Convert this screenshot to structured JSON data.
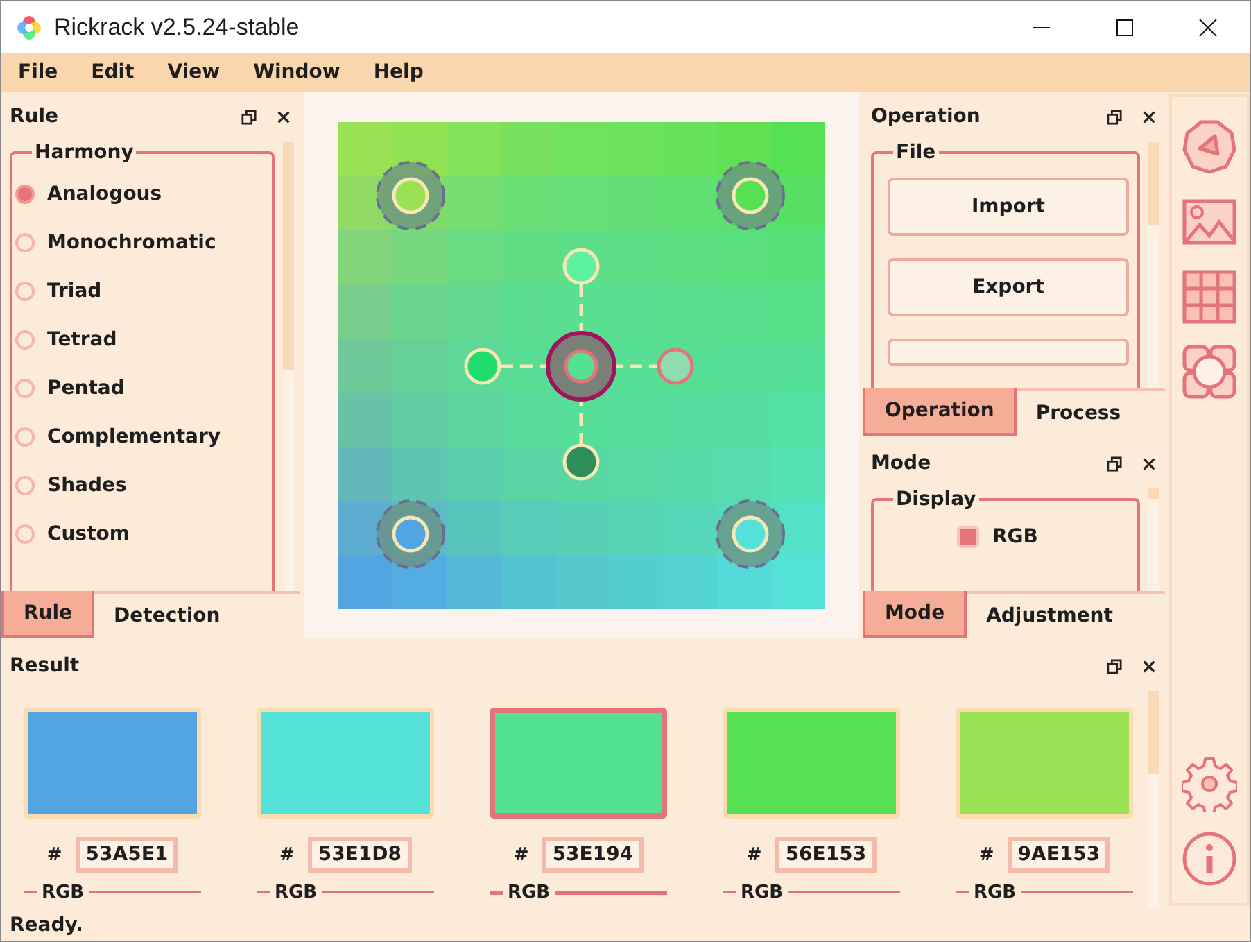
{
  "window": {
    "title": "Rickrack v2.5.24-stable"
  },
  "menu": [
    "File",
    "Edit",
    "View",
    "Window",
    "Help"
  ],
  "rule_panel": {
    "title": "Rule",
    "group": "Harmony",
    "options": [
      {
        "label": "Analogous",
        "selected": true
      },
      {
        "label": "Monochromatic",
        "selected": false
      },
      {
        "label": "Triad",
        "selected": false
      },
      {
        "label": "Tetrad",
        "selected": false
      },
      {
        "label": "Pentad",
        "selected": false
      },
      {
        "label": "Complementary",
        "selected": false
      },
      {
        "label": "Shades",
        "selected": false
      },
      {
        "label": "Custom",
        "selected": false
      }
    ],
    "tabs": [
      {
        "label": "Rule",
        "selected": true
      },
      {
        "label": "Detection",
        "selected": false
      }
    ]
  },
  "operation_panel": {
    "title": "Operation",
    "group": "File",
    "buttons": [
      "Import",
      "Export"
    ],
    "tabs": [
      {
        "label": "Operation",
        "selected": true
      },
      {
        "label": "Process",
        "selected": false
      }
    ]
  },
  "mode_panel": {
    "title": "Mode",
    "group": "Display",
    "options": [
      {
        "label": "RGB",
        "checked": true
      }
    ],
    "tabs": [
      {
        "label": "Mode",
        "selected": true
      },
      {
        "label": "Adjustment",
        "selected": false
      }
    ]
  },
  "result_panel": {
    "title": "Result",
    "swatches": [
      {
        "color": "#53a5e1",
        "prefix": "#",
        "hex": "53A5E1",
        "group": "RGB",
        "selected": false
      },
      {
        "color": "#53e1d8",
        "prefix": "#",
        "hex": "53E1D8",
        "group": "RGB",
        "selected": false
      },
      {
        "color": "#53e194",
        "prefix": "#",
        "hex": "53E194",
        "group": "RGB",
        "selected": true
      },
      {
        "color": "#56e153",
        "prefix": "#",
        "hex": "56E153",
        "group": "RGB",
        "selected": false
      },
      {
        "color": "#9ae153",
        "prefix": "#",
        "hex": "9AE153",
        "group": "RGB",
        "selected": false
      }
    ]
  },
  "status_bar": "Ready."
}
